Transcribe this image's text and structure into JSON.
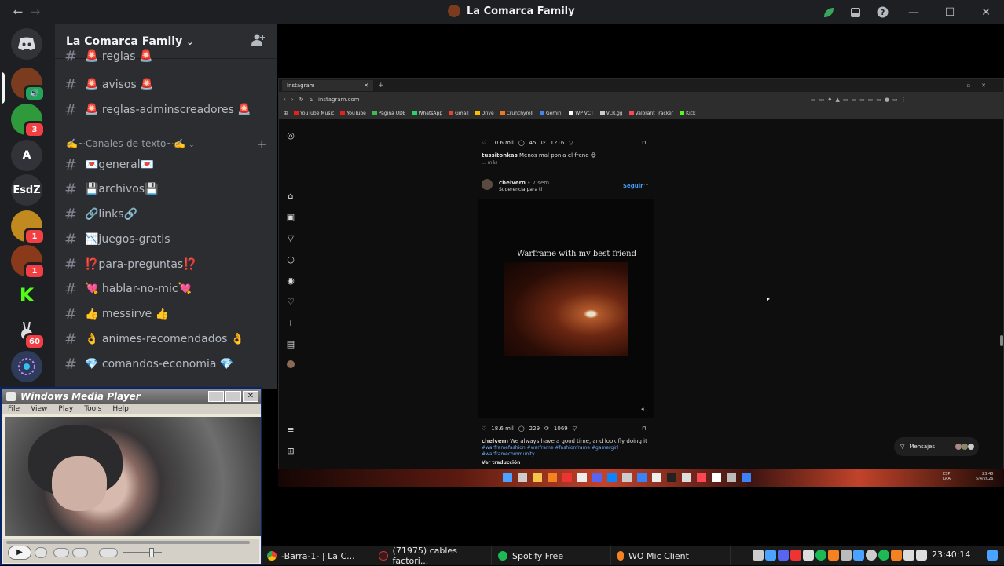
{
  "titlebar": {
    "title": "La Comarca Family",
    "back": "←",
    "forward": "→"
  },
  "rail": {
    "servers": [
      {
        "label": "",
        "badge": "",
        "color": "#5865f2"
      },
      {
        "label": "",
        "badge": "",
        "color": "#7a3b1e"
      },
      {
        "label": "",
        "badge": "3",
        "color": "#2e9a3c"
      },
      {
        "label": "A",
        "badge": "",
        "color": "#313338"
      },
      {
        "label": "EsdZ",
        "badge": "",
        "color": "#313338"
      },
      {
        "label": "",
        "badge": "1",
        "color": "#c08a1e"
      },
      {
        "label": "",
        "badge": "1",
        "color": "#8a3a1a"
      },
      {
        "label": "K",
        "badge": "",
        "color": "#1e1f22"
      },
      {
        "label": "",
        "badge": "60",
        "color": "#1e1f22"
      },
      {
        "label": "",
        "badge": "",
        "color": "#2e3b5a"
      }
    ]
  },
  "guild": {
    "name": "La Comarca Family"
  },
  "channels": {
    "top": [
      {
        "name": "🚨 reglas 🚨"
      },
      {
        "name": "🚨 avisos 🚨"
      },
      {
        "name": "🚨 reglas-adminscreadores 🚨"
      }
    ],
    "category": "✍️~Canales-de-texto~✍️",
    "text": [
      {
        "name": "💌general💌"
      },
      {
        "name": "💾archivos💾"
      },
      {
        "name": "🔗links🔗"
      },
      {
        "name": "📉juegos-gratis"
      },
      {
        "name": "⁉️para-preguntas⁉️"
      },
      {
        "name": "💘 hablar-no-mic💘"
      },
      {
        "name": "👍 messirve 👍"
      },
      {
        "name": "👌 animes-recomendados 👌"
      },
      {
        "name": "💎 comandos-economia 💎"
      }
    ]
  },
  "browser": {
    "tab": "Instagram",
    "url": "instagram.com",
    "bookmarks": [
      "YouTube Music",
      "YouTube",
      "Pagina UDE",
      "WhatsApp",
      "Gmail",
      "Drive",
      "Crunchyroll",
      "Gemini",
      "WP VCT",
      "VLR.gg",
      "Valorant Tracker",
      "Kick"
    ],
    "post1": {
      "likes": "10.6 mil",
      "comments": "45",
      "shares": "1216",
      "user": "tussitonkas",
      "caption": "Menos mal ponia el freno 😅",
      "more": "... más"
    },
    "post2": {
      "user": "chelvern",
      "time": "• 7 sem",
      "suggest": "Sugerencia para ti",
      "follow": "Seguir",
      "overlay": "Warframe with my best friend",
      "likes": "18.6 mil",
      "comments": "229",
      "shares": "1069",
      "caption_user": "chelvern",
      "caption": "We always have a good time, and look fly doing it",
      "tags1": "#warframefashion #warframe #fashionframe #gamergirl",
      "tags2": "#warframecommunity",
      "translate": "Ver traducción"
    },
    "messages": "Mensajes",
    "clock1": "23:40",
    "clock2": "5/4/2026",
    "lang1": "ESP",
    "lang2": "LAA"
  },
  "wmp": {
    "title": "Windows Media Player",
    "menu": [
      "File",
      "View",
      "Play",
      "Tools",
      "Help"
    ]
  },
  "taskbar": {
    "tasks": [
      "-Barra-1- | La C...",
      "(71975) cables factori...",
      "Spotify Free",
      "WO Mic Client"
    ],
    "clock": "23:40:14"
  }
}
